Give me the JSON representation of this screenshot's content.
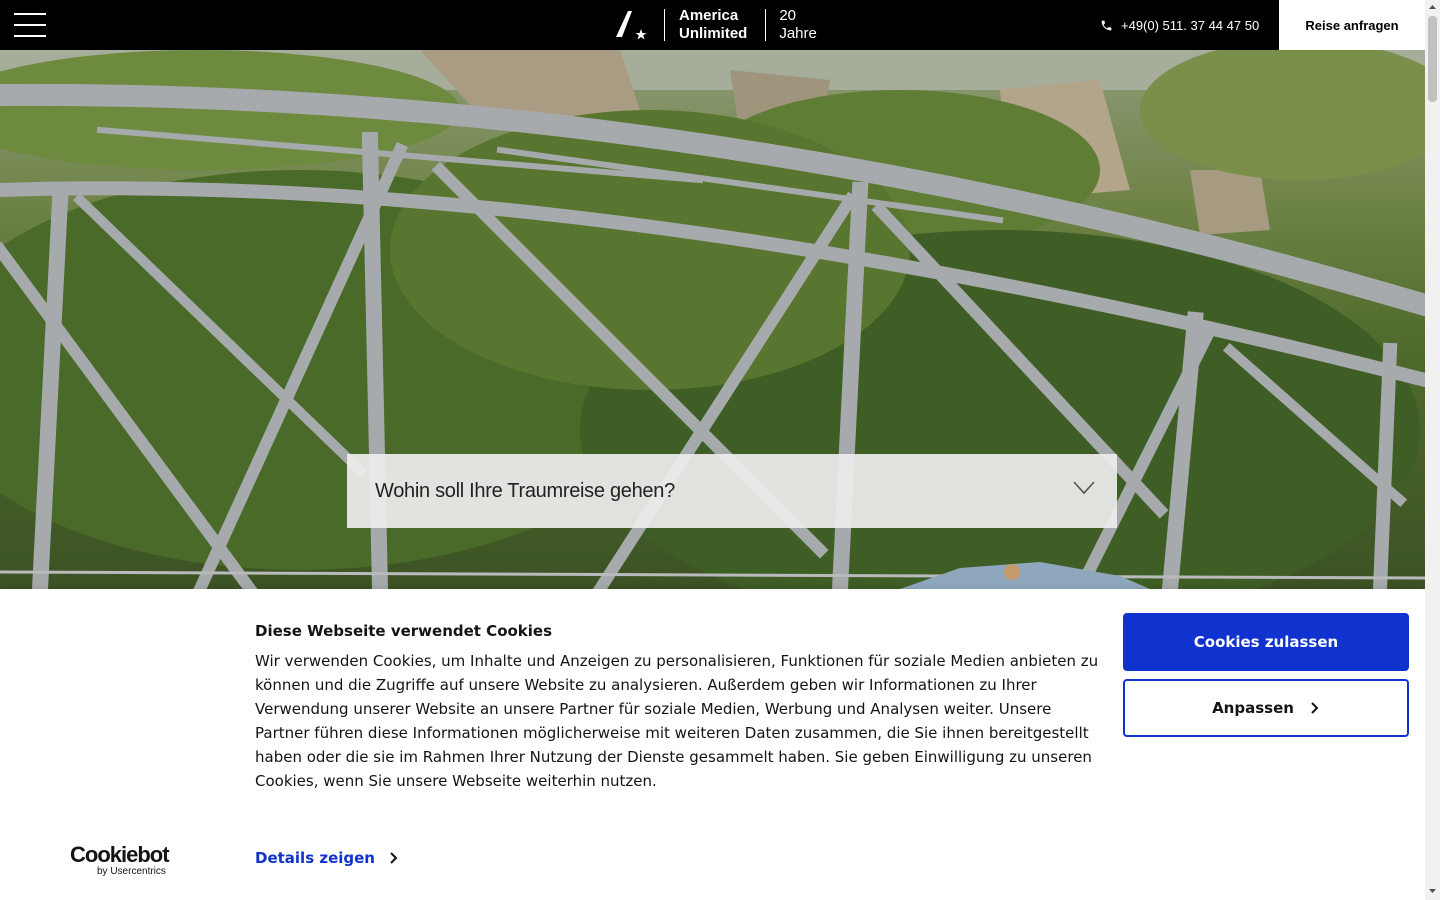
{
  "header": {
    "menu_icon": "hamburger-menu-icon",
    "logo_line1": "America",
    "logo_line2": "Unlimited",
    "logo_years_line1": "20",
    "logo_years_line2": "Jahre",
    "phone_icon": "phone-icon",
    "phone": "+49(0) 511. 37 44 47 50",
    "cta_label": "Reise anfragen"
  },
  "hero": {
    "destination_placeholder": "Wohin soll Ihre Traumreise gehen?",
    "dropdown_icon": "chevron-down-icon"
  },
  "cookie_banner": {
    "title": "Diese Webseite verwendet Cookies",
    "body": "Wir verwenden Cookies, um Inhalte und Anzeigen zu personalisieren, Funktionen für soziale Medien anbieten zu können und die Zugriffe auf unsere Website zu analysieren. Außerdem geben wir Informationen zu Ihrer Verwendung unserer Website an unsere Partner für soziale Medien, Werbung und Analysen weiter. Unsere Partner führen diese Informationen möglicherweise mit weiteren Daten zusammen, die Sie ihnen bereitgestellt haben oder die sie im Rahmen Ihrer Nutzung der Dienste gesammelt haben. Sie geben Einwilligung zu unseren Cookies, wenn Sie unsere Webseite weiterhin nutzen.",
    "details_label": "Details zeigen",
    "allow_label": "Cookies zulassen",
    "customize_label": "Anpassen",
    "brand": "Cookiebot",
    "brand_sub": "by Usercentrics",
    "accent_color": "#1032cf"
  }
}
